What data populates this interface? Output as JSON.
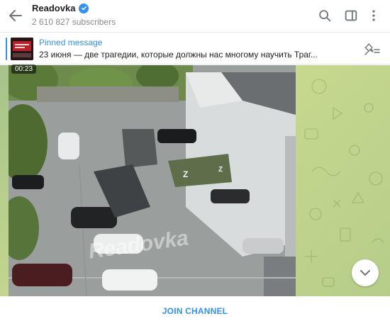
{
  "header": {
    "title": "Readovka",
    "subscribers": "2 610 827 subscribers",
    "icons": [
      "back-arrow-icon",
      "verified-icon",
      "search-icon",
      "sidebar-toggle-icon",
      "more-vertical-icon"
    ]
  },
  "pinned": {
    "title": "Pinned message",
    "text": "23 июня — две трагедии, которые должны нас многому научить  Траг..."
  },
  "video": {
    "duration": "00:23",
    "watermark": "Readovka"
  },
  "footer": {
    "join_label": "JOIN CHANNEL"
  },
  "colors": {
    "accent": "#3390ec",
    "chat_background": "#b5cd8a"
  }
}
